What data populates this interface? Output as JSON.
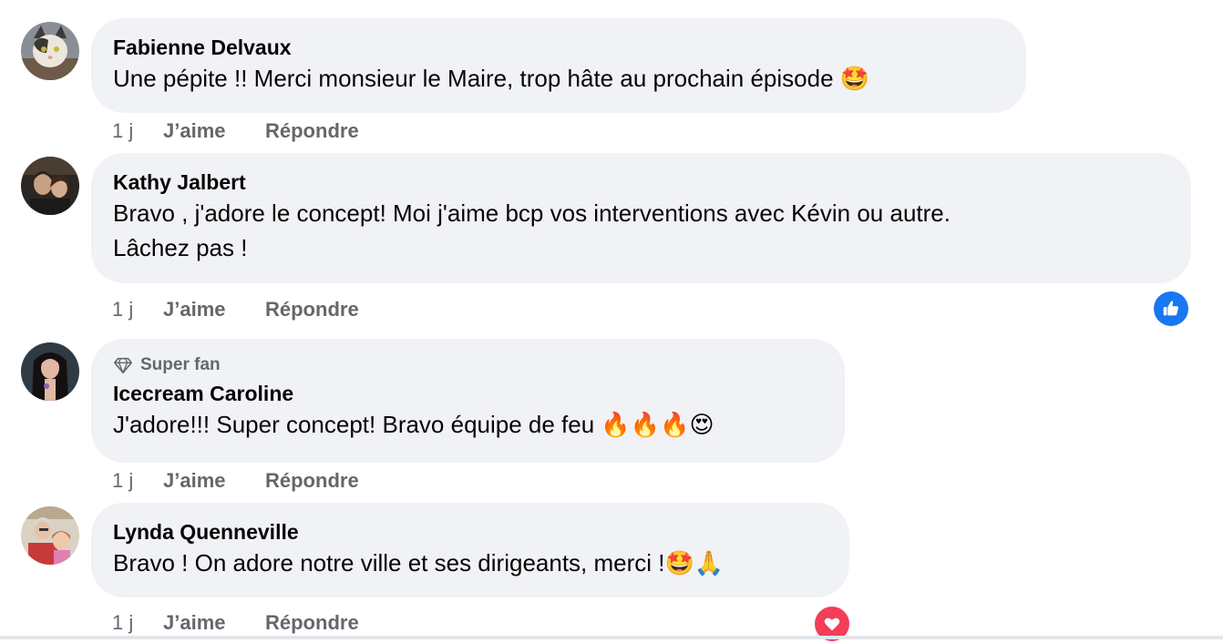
{
  "comments": [
    {
      "author": "Fabienne Delvaux",
      "text": "Une pépite !! Merci monsieur le Maire, trop hâte au prochain épisode 🤩",
      "time": "1 j",
      "like_label": "J’aime",
      "reply_label": "Répondre",
      "avatar_icon": "cat-avatar"
    },
    {
      "author": "Kathy Jalbert",
      "text_line1": "Bravo , j'adore le concept! Moi j'aime bcp vos interventions avec Kévin ou autre.",
      "text_line2": "Lâchez pas !",
      "time": "1 j",
      "like_label": "J’aime",
      "reply_label": "Répondre",
      "reaction_icon": "like-thumb-icon",
      "reaction_color": "#1877f2",
      "avatar_icon": "couple-avatar"
    },
    {
      "badge": "Super fan",
      "badge_icon": "diamond-icon",
      "author": "Icecream Caroline",
      "text": "J'adore!!! Super concept! Bravo équipe de feu 🔥🔥🔥😍",
      "time": "1 j",
      "like_label": "J’aime",
      "reply_label": "Répondre",
      "avatar_icon": "woman-avatar"
    },
    {
      "author": "Lynda Quenneville",
      "text": "Bravo ! On adore notre ville et ses dirigeants, merci !🤩🙏",
      "time": "1 j",
      "like_label": "J’aime",
      "reply_label": "Répondre",
      "reaction_icon": "heart-icon",
      "reaction_color": "#f33e58",
      "avatar_icon": "family-avatar"
    }
  ]
}
